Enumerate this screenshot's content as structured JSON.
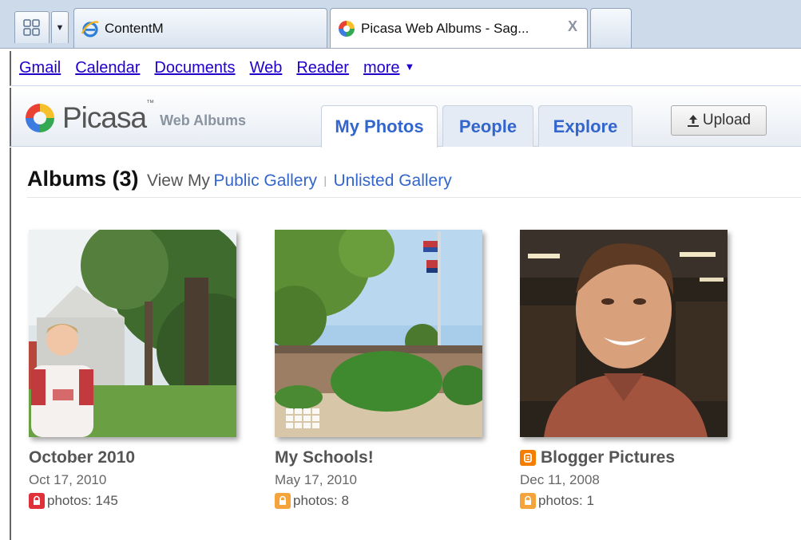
{
  "browser": {
    "tabs": [
      {
        "label": "ContentM",
        "icon": "ie-icon",
        "active": false
      },
      {
        "label": "Picasa Web Albums - Sag...",
        "icon": "picasa-icon",
        "active": true,
        "close_glyph": "X"
      }
    ]
  },
  "gbar": {
    "links": [
      "Gmail",
      "Calendar",
      "Documents",
      "Web",
      "Reader",
      "more"
    ],
    "more_arrow": "▼"
  },
  "header": {
    "logo_word": "Picasa",
    "logo_tm": "™",
    "logo_sub": "Web Albums",
    "tabs": [
      {
        "label": "My Photos",
        "active": true
      },
      {
        "label": "People",
        "active": false
      },
      {
        "label": "Explore",
        "active": false
      }
    ],
    "upload_label": "Upload"
  },
  "main": {
    "heading": "Albums (3)",
    "view_my": "View My",
    "public_gallery": "Public Gallery",
    "separator": "|",
    "unlisted_gallery": "Unlisted Gallery",
    "albums": [
      {
        "title": "October 2010",
        "date": "Oct 17, 2010",
        "count": "photos: 145",
        "lock_color": "#e0303a"
      },
      {
        "title": "My Schools!",
        "date": "May 17, 2010",
        "count": "photos: 8",
        "lock_color": "#f4a43a"
      },
      {
        "title": "Blogger Pictures",
        "date": "Dec 11, 2008",
        "count": "photos: 1",
        "lock_color": "#f4a43a",
        "badge_icon": "blogger-icon"
      }
    ]
  },
  "colors": {
    "link": "#2200cc",
    "picasa_blue": "#3366cc",
    "tabstrip": "#ccdaea"
  }
}
